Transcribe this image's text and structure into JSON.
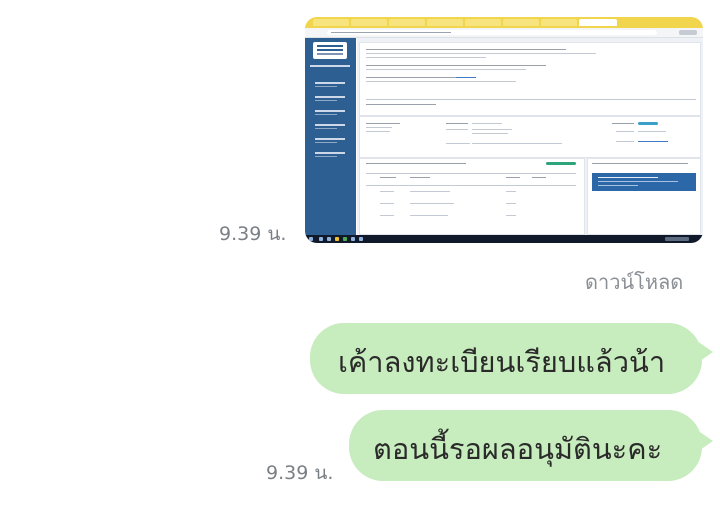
{
  "chat": {
    "messages": [
      {
        "type": "image",
        "time": "9.39 น.",
        "action": "ดาวน์โหลด"
      },
      {
        "type": "text",
        "text": "เค้าลงทะเบียนเรียบแล้วน้า"
      },
      {
        "type": "text",
        "text": "ตอนนี้รอผลอนุมัตินะคะ",
        "time": "9.39 น."
      }
    ]
  },
  "colors": {
    "bubble": "#c7ecbd",
    "time_text": "#7a7f85",
    "sidebar": "#2e5f92",
    "tabbar": "#f1d54c"
  }
}
